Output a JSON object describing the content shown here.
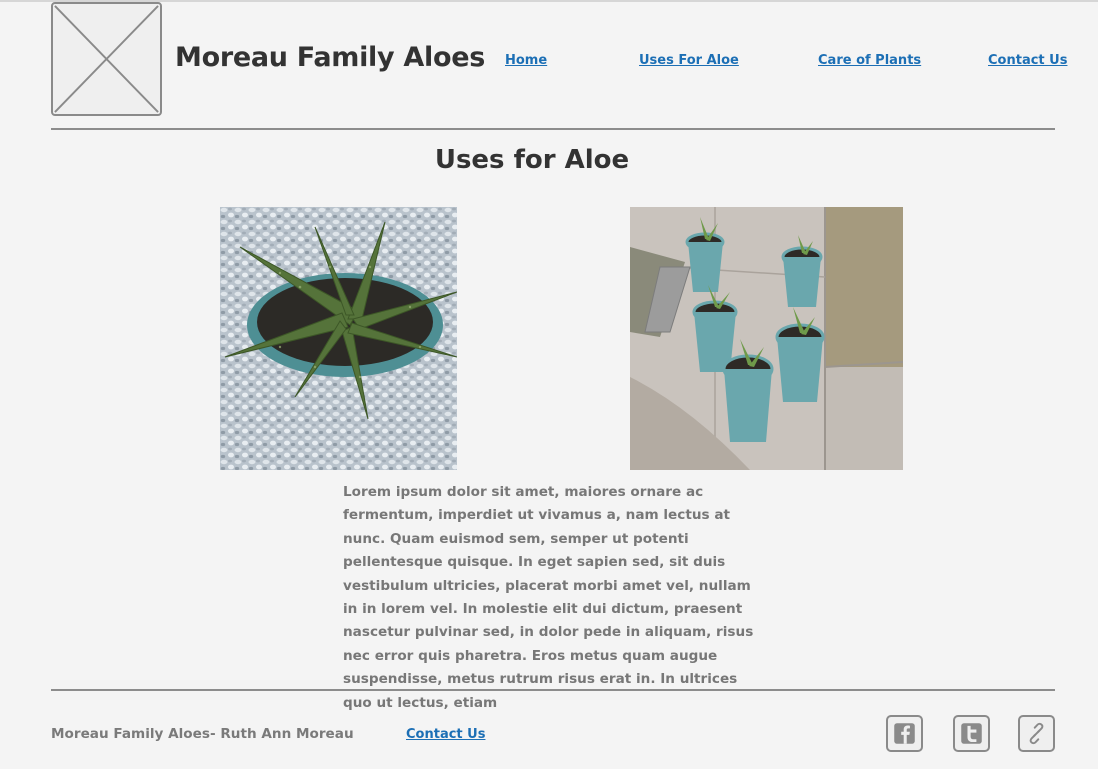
{
  "header": {
    "site_title": "Moreau Family Aloes",
    "logo_icon": "image-placeholder-icon"
  },
  "nav": {
    "items": [
      {
        "label": "Home"
      },
      {
        "label": "Uses For Aloe"
      },
      {
        "label": "Care of Plants"
      },
      {
        "label": "Contact Us"
      }
    ]
  },
  "main": {
    "heading": "Uses for Aloe",
    "images": [
      {
        "subject": "potted-aloe-on-gravel"
      },
      {
        "subject": "five-potted-aloe-seedlings-on-sidewalk"
      }
    ],
    "body": "Lorem ipsum dolor sit amet, maiores ornare ac fermentum, imperdiet ut vivamus a, nam lectus at nunc. Quam euismod sem, semper ut potenti pellentesque quisque. In eget sapien sed, sit duis vestibulum ultricies, placerat morbi amet vel, nullam in in lorem vel. In molestie elit dui dictum, praesent nascetur pulvinar sed, in dolor pede in aliquam, risus nec error quis pharetra. Eros metus quam augue suspendisse, metus rutrum risus erat in.  In ultrices quo ut lectus, etiam"
  },
  "footer": {
    "credit": "Moreau Family Aloes- Ruth Ann Moreau",
    "contact_label": "Contact Us",
    "social": [
      {
        "icon": "facebook-icon"
      },
      {
        "icon": "twitter-icon"
      },
      {
        "icon": "link-icon"
      }
    ]
  },
  "colors": {
    "background": "#f4f4f4",
    "link": "#1c6fb5",
    "text": "#333333",
    "muted_text": "#777777",
    "rule": "#8c8c8c"
  }
}
